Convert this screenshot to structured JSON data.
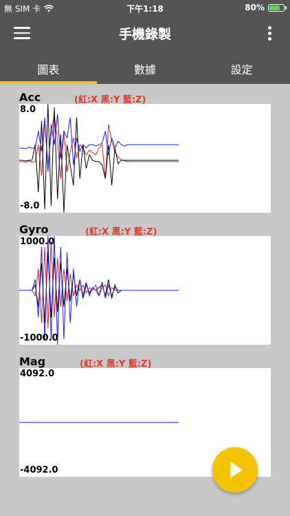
{
  "status": {
    "carrier": "無 SIM 卡",
    "time": "下午1:18",
    "battery": "80%",
    "battery_level": 0.8
  },
  "app_bar": {
    "title": "手機錄製"
  },
  "tabs": [
    {
      "label": "圖表",
      "active": true
    },
    {
      "label": "數據",
      "active": false
    },
    {
      "label": "設定",
      "active": false
    }
  ],
  "colors": {
    "x": "#e02020",
    "y": "#000000",
    "z": "#1a1aff",
    "accent": "#f5c400",
    "bar": "#545454"
  },
  "chart_data": [
    {
      "type": "line",
      "title": "Acc",
      "legend": "(紅:X  黑:Y  藍:Z)",
      "ylim": [
        -8.0,
        8.0
      ],
      "ymax_label": "8.0",
      "ymin_label": "-8.0",
      "x": [
        0,
        2,
        4,
        6,
        8,
        10,
        12,
        14,
        16,
        18,
        20,
        22,
        24,
        26,
        28,
        30,
        32,
        34,
        36,
        38,
        40,
        42,
        44,
        46,
        48,
        50,
        52,
        54,
        56,
        58,
        60,
        62,
        64,
        66,
        68,
        70,
        72,
        74,
        76,
        78,
        80,
        82,
        84,
        86,
        88,
        90,
        92,
        94,
        96,
        98,
        100
      ],
      "series": [
        {
          "name": "X",
          "values": [
            -0.5,
            -0.5,
            -0.6,
            -0.4,
            -0.6,
            -0.5,
            2.0,
            -2.5,
            5.5,
            -1.0,
            3.5,
            6.5,
            2.5,
            -3.0,
            4.0,
            -2.0,
            1.0,
            3.0,
            0.0,
            2.0,
            1.5,
            0.5,
            1.2,
            0.8,
            0.5,
            1.5,
            2.0,
            -3.0,
            5.0,
            2.5,
            1.0,
            0.2,
            -0.2,
            -0.4,
            -0.5,
            -0.5,
            -0.5,
            -0.5,
            -0.5,
            -0.5,
            -0.5,
            -0.5,
            -0.5,
            -0.5,
            -0.5,
            -0.5,
            -0.5,
            -0.5,
            -0.5,
            -0.5,
            -0.5
          ]
        },
        {
          "name": "Y",
          "values": [
            -0.3,
            -0.3,
            -0.4,
            -0.3,
            -0.3,
            2.0,
            -5.0,
            5.5,
            -7.5,
            8.0,
            -7.0,
            7.5,
            -6.0,
            3.5,
            -8.0,
            2.0,
            -1.0,
            -4.0,
            6.0,
            -3.0,
            2.0,
            -1.5,
            0.5,
            -0.3,
            -0.5,
            -0.5,
            -1.0,
            -3.0,
            2.0,
            -4.0,
            1.5,
            -0.8,
            -0.3,
            -0.3,
            -0.3,
            -0.3,
            -0.3,
            -0.3,
            -0.3,
            -0.3,
            -0.3,
            -0.3,
            -0.3,
            -0.3,
            -0.3,
            -0.3,
            -0.3,
            -0.3,
            -0.3,
            -0.3,
            -0.3
          ]
        },
        {
          "name": "Z",
          "values": [
            1.5,
            1.5,
            1.4,
            1.6,
            1.5,
            1.5,
            4.0,
            1.0,
            6.0,
            -2.0,
            5.0,
            2.0,
            6.5,
            0.0,
            4.0,
            3.0,
            6.0,
            -1.0,
            3.0,
            1.0,
            2.0,
            1.5,
            2.0,
            2.0,
            1.8,
            2.0,
            2.2,
            4.0,
            0.5,
            3.0,
            1.5,
            2.5,
            2.0,
            1.8,
            2.0,
            2.0,
            2.0,
            2.0,
            2.0,
            2.0,
            2.0,
            2.0,
            2.0,
            2.0,
            2.0,
            2.0,
            2.0,
            2.0,
            2.0,
            2.0,
            2.0
          ]
        }
      ]
    },
    {
      "type": "line",
      "title": "Gyro",
      "legend": "(紅:X  黑:Y  藍:Z)",
      "ylim": [
        -1000.0,
        1000.0
      ],
      "ymax_label": "1000.0",
      "ymin_label": "-1000.0",
      "x": [
        0,
        2,
        4,
        6,
        8,
        10,
        12,
        14,
        16,
        18,
        20,
        22,
        24,
        26,
        28,
        30,
        32,
        34,
        36,
        38,
        40,
        42,
        44,
        46,
        48,
        50,
        52,
        54,
        56,
        58,
        60,
        62,
        64,
        66,
        68,
        70,
        72,
        74,
        76,
        78,
        80,
        82,
        84,
        86,
        88,
        90,
        92,
        94,
        96,
        98,
        100
      ],
      "series": [
        {
          "name": "X",
          "values": [
            0,
            0,
            0,
            0,
            0,
            -100,
            400,
            -600,
            800,
            -700,
            900,
            -500,
            600,
            -300,
            400,
            -200,
            300,
            -100,
            100,
            0,
            100,
            -50,
            50,
            0,
            100,
            -100,
            50,
            100,
            -100,
            50,
            0,
            0,
            0,
            0,
            0,
            0,
            0,
            0,
            0,
            0,
            0,
            0,
            0,
            0,
            0,
            0,
            0,
            0,
            0,
            0,
            0
          ]
        },
        {
          "name": "Y",
          "values": [
            0,
            0,
            0,
            0,
            0,
            100,
            -300,
            500,
            -600,
            700,
            -500,
            600,
            -400,
            500,
            -300,
            400,
            -200,
            300,
            -100,
            200,
            -150,
            100,
            -50,
            50,
            0,
            50,
            100,
            -100,
            200,
            -150,
            100,
            -50,
            0,
            0,
            0,
            0,
            0,
            0,
            0,
            0,
            0,
            0,
            0,
            0,
            0,
            0,
            0,
            0,
            0,
            0,
            0
          ]
        },
        {
          "name": "Z",
          "values": [
            0,
            0,
            0,
            0,
            0,
            200,
            -500,
            800,
            -900,
            1000,
            -900,
            1000,
            -1000,
            800,
            -900,
            700,
            -600,
            400,
            -300,
            200,
            -100,
            150,
            -100,
            50,
            0,
            -100,
            150,
            -150,
            100,
            -100,
            50,
            0,
            0,
            0,
            0,
            0,
            0,
            0,
            0,
            0,
            0,
            0,
            0,
            0,
            0,
            0,
            0,
            0,
            0,
            0,
            0
          ]
        }
      ]
    },
    {
      "type": "line",
      "title": "Mag",
      "legend": "(紅:X  黑:Y  藍:Z)",
      "ylim": [
        -4092.0,
        4092.0
      ],
      "ymax_label": "4092.0",
      "ymin_label": "-4092.0",
      "x": [
        0,
        100
      ],
      "series": [
        {
          "name": "X",
          "values": [
            0,
            0
          ]
        },
        {
          "name": "Y",
          "values": [
            0,
            0
          ]
        },
        {
          "name": "Z",
          "values": [
            0,
            0
          ]
        }
      ]
    }
  ]
}
